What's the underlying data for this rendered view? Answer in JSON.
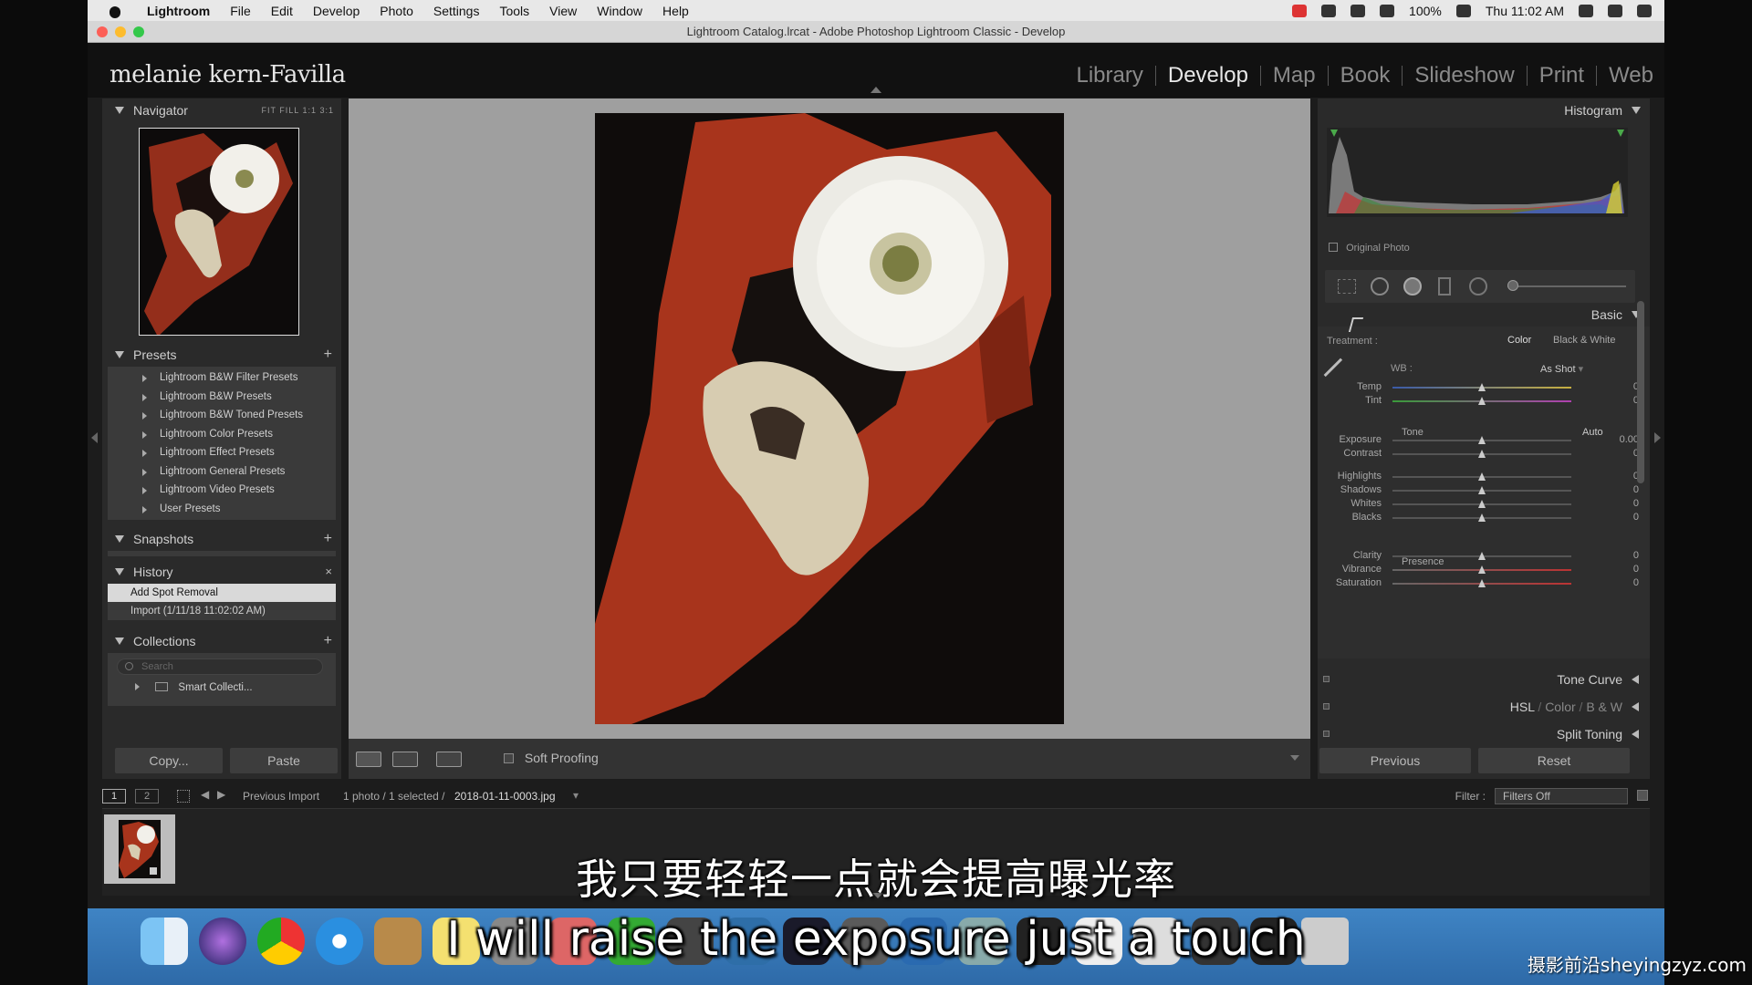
{
  "menubar": {
    "items": [
      "Lightroom",
      "File",
      "Edit",
      "Develop",
      "Photo",
      "Settings",
      "Tools",
      "View",
      "Window",
      "Help"
    ],
    "battery": "100%",
    "clock": "Thu 11:02 AM"
  },
  "window": {
    "title": "Lightroom Catalog.lrcat - Adobe Photoshop Lightroom Classic - Develop"
  },
  "identity_plate": "melanie kern-Favilla",
  "modules": [
    "Library",
    "Develop",
    "Map",
    "Book",
    "Slideshow",
    "Print",
    "Web"
  ],
  "active_module": "Develop",
  "left": {
    "navigator": {
      "title": "Navigator",
      "options": "FIT   FILL   1:1   3:1"
    },
    "presets": {
      "title": "Presets",
      "items": [
        "Lightroom B&W Filter Presets",
        "Lightroom B&W Presets",
        "Lightroom B&W Toned Presets",
        "Lightroom Color Presets",
        "Lightroom Effect Presets",
        "Lightroom General Presets",
        "Lightroom Video Presets",
        "User Presets"
      ]
    },
    "snapshots": {
      "title": "Snapshots"
    },
    "history": {
      "title": "History",
      "items": [
        "Add Spot Removal",
        "Import (1/11/18 11:02:02 AM)"
      ]
    },
    "collections": {
      "title": "Collections",
      "search_placeholder": "Search",
      "items": [
        "Smart Collecti..."
      ]
    },
    "copy_label": "Copy...",
    "paste_label": "Paste"
  },
  "toolbar": {
    "soft_proofing": "Soft Proofing"
  },
  "right": {
    "histogram": {
      "title": "Histogram",
      "original_photo": "Original Photo"
    },
    "basic": {
      "title": "Basic",
      "treatment_label": "Treatment :",
      "treatment_color": "Color",
      "treatment_bw": "Black & White",
      "wb_label": "WB :",
      "wb_value": "As Shot",
      "tone_label": "Tone",
      "auto_label": "Auto",
      "presence_label": "Presence",
      "sliders": [
        {
          "label": "Temp",
          "value": "0"
        },
        {
          "label": "Tint",
          "value": "0"
        },
        {
          "label": "Exposure",
          "value": "0.00"
        },
        {
          "label": "Contrast",
          "value": "0"
        },
        {
          "label": "Highlights",
          "value": "0"
        },
        {
          "label": "Shadows",
          "value": "0"
        },
        {
          "label": "Whites",
          "value": "0"
        },
        {
          "label": "Blacks",
          "value": "0"
        },
        {
          "label": "Clarity",
          "value": "0"
        },
        {
          "label": "Vibrance",
          "value": "0"
        },
        {
          "label": "Saturation",
          "value": "0"
        }
      ]
    },
    "tone_curve": "Tone Curve",
    "hsl": {
      "hsl": "HSL",
      "color": "Color",
      "bw": "B & W",
      "slash": "/"
    },
    "split_toning": "Split Toning",
    "previous_label": "Previous",
    "reset_label": "Reset"
  },
  "statusbar": {
    "view1": "1",
    "view2": "2",
    "source": "Previous Import",
    "count": "1 photo / 1 selected /",
    "filename": "2018-01-11-0003.jpg",
    "filter_label": "Filter :",
    "filter_value": "Filters Off"
  },
  "subtitles": {
    "zh": "我只要轻轻一点就会提高曝光率",
    "en": "I will raise the exposure just a touch"
  },
  "watermark": "摄影前沿sheyingzyz.com",
  "colors": {
    "panel_bg": "#2a2a2a",
    "canvas_bg": "#9f9f9f",
    "selected_row": "#d9d9d9",
    "dock_blue": "#3f84c4"
  }
}
